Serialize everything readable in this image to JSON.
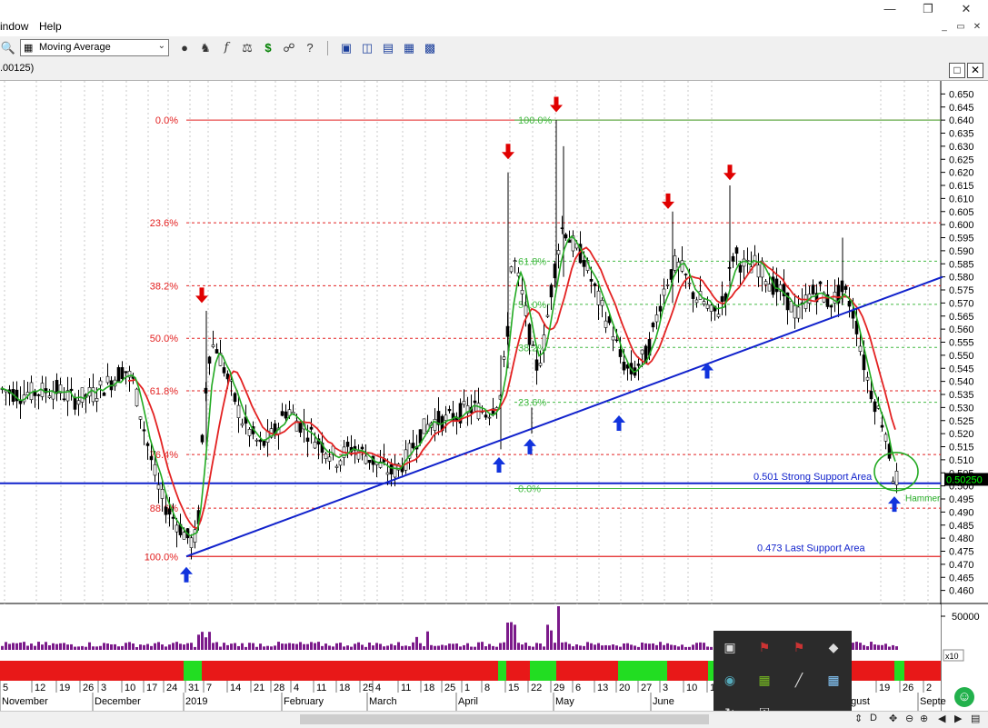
{
  "menu": {
    "window_label": "indow",
    "help_label": "Help"
  },
  "toolbar": {
    "indicator_select": "Moving Average"
  },
  "chart_window": {
    "title_fragment": ".00125)"
  },
  "chart_data": {
    "type": "candlestick",
    "title": "",
    "ylim": [
      0.455,
      0.655
    ],
    "y_ticks": [
      0.65,
      0.645,
      0.64,
      0.635,
      0.63,
      0.625,
      0.62,
      0.615,
      0.61,
      0.605,
      0.6,
      0.595,
      0.59,
      0.585,
      0.58,
      0.575,
      0.57,
      0.565,
      0.56,
      0.555,
      0.55,
      0.545,
      0.54,
      0.535,
      0.53,
      0.525,
      0.52,
      0.515,
      0.51,
      0.505,
      0.5,
      0.495,
      0.49,
      0.485,
      0.48,
      0.475,
      0.47,
      0.465,
      0.46
    ],
    "y_tick_labels": [
      "0.650",
      "0.645",
      "0.640",
      "0.635",
      "0.630",
      "0.625",
      "0.620",
      "0.615",
      "0.610",
      "0.605",
      "0.600",
      "0.595",
      "0.590",
      "0.585",
      "0.580",
      "0.575",
      "0.570",
      "0.565",
      "0.560",
      "0.555",
      "0.550",
      "0.545",
      "0.540",
      "0.535",
      "0.530",
      "0.525",
      "0.520",
      "0.515",
      "0.510",
      "0.505",
      "0.500",
      "0.495",
      "0.490",
      "0.485",
      "0.480",
      "0.475",
      "0.470",
      "0.465",
      "0.460"
    ],
    "last_price_label": "0.50250",
    "last_price": 0.5025,
    "price_path": [
      [
        0,
        0.537
      ],
      [
        20,
        0.535
      ],
      [
        40,
        0.536
      ],
      [
        60,
        0.537
      ],
      [
        80,
        0.533
      ],
      [
        100,
        0.535
      ],
      [
        120,
        0.54
      ],
      [
        135,
        0.545
      ],
      [
        145,
        0.54
      ],
      [
        155,
        0.525
      ],
      [
        165,
        0.51
      ],
      [
        175,
        0.496
      ],
      [
        185,
        0.49
      ],
      [
        195,
        0.485
      ],
      [
        205,
        0.48
      ],
      [
        212,
        0.478
      ],
      [
        218,
        0.49
      ],
      [
        222,
        0.525
      ],
      [
        228,
        0.55
      ],
      [
        235,
        0.555
      ],
      [
        245,
        0.545
      ],
      [
        255,
        0.535
      ],
      [
        265,
        0.525
      ],
      [
        275,
        0.52
      ],
      [
        285,
        0.515
      ],
      [
        300,
        0.52
      ],
      [
        315,
        0.53
      ],
      [
        325,
        0.525
      ],
      [
        340,
        0.52
      ],
      [
        355,
        0.515
      ],
      [
        370,
        0.51
      ],
      [
        385,
        0.515
      ],
      [
        400,
        0.512
      ],
      [
        415,
        0.508
      ],
      [
        430,
        0.505
      ],
      [
        445,
        0.51
      ],
      [
        460,
        0.52
      ],
      [
        475,
        0.525
      ],
      [
        490,
        0.525
      ],
      [
        505,
        0.528
      ],
      [
        520,
        0.53
      ],
      [
        535,
        0.528
      ],
      [
        550,
        0.535
      ],
      [
        557,
        0.56
      ],
      [
        562,
        0.59
      ],
      [
        568,
        0.58
      ],
      [
        575,
        0.57
      ],
      [
        580,
        0.56
      ],
      [
        585,
        0.55
      ],
      [
        590,
        0.545
      ],
      [
        597,
        0.555
      ],
      [
        605,
        0.575
      ],
      [
        612,
        0.59
      ],
      [
        618,
        0.6
      ],
      [
        625,
        0.595
      ],
      [
        632,
        0.59
      ],
      [
        640,
        0.588
      ],
      [
        648,
        0.58
      ],
      [
        656,
        0.572
      ],
      [
        664,
        0.565
      ],
      [
        672,
        0.56
      ],
      [
        680,
        0.55
      ],
      [
        688,
        0.545
      ],
      [
        695,
        0.543
      ],
      [
        703,
        0.548
      ],
      [
        710,
        0.55
      ],
      [
        718,
        0.56
      ],
      [
        726,
        0.572
      ],
      [
        734,
        0.58
      ],
      [
        742,
        0.585
      ],
      [
        750,
        0.582
      ],
      [
        758,
        0.575
      ],
      [
        766,
        0.572
      ],
      [
        774,
        0.57
      ],
      [
        782,
        0.565
      ],
      [
        790,
        0.568
      ],
      [
        798,
        0.575
      ],
      [
        806,
        0.59
      ],
      [
        814,
        0.585
      ],
      [
        822,
        0.583
      ],
      [
        830,
        0.585
      ],
      [
        838,
        0.582
      ],
      [
        846,
        0.578
      ],
      [
        854,
        0.575
      ],
      [
        862,
        0.573
      ],
      [
        870,
        0.568
      ],
      [
        878,
        0.565
      ],
      [
        886,
        0.572
      ],
      [
        894,
        0.574
      ],
      [
        902,
        0.575
      ],
      [
        910,
        0.57
      ],
      [
        918,
        0.572
      ],
      [
        926,
        0.575
      ],
      [
        934,
        0.57
      ],
      [
        942,
        0.56
      ],
      [
        950,
        0.545
      ],
      [
        958,
        0.535
      ],
      [
        966,
        0.528
      ],
      [
        974,
        0.52
      ],
      [
        980,
        0.5045
      ],
      [
        986,
        0.5025
      ]
    ],
    "fibonacci_left": {
      "levels": [
        {
          "label": "0.0%",
          "value": 0.64
        },
        {
          "label": "23.6%",
          "value": 0.6007
        },
        {
          "label": "38.2%",
          "value": 0.5766
        },
        {
          "label": "50.0%",
          "value": 0.5565
        },
        {
          "label": "61.8%",
          "value": 0.5364
        },
        {
          "label": "76.4%",
          "value": 0.512
        },
        {
          "label": "88.6%",
          "value": 0.4915
        },
        {
          "label": "100.0%",
          "value": 0.473
        }
      ]
    },
    "fibonacci_right": {
      "levels": [
        {
          "label": "100.0%",
          "value": 0.64
        },
        {
          "label": "61.8%",
          "value": 0.586
        },
        {
          "label": "50.0%",
          "value": 0.5695
        },
        {
          "label": "38.2%",
          "value": 0.553
        },
        {
          "label": "23.6%",
          "value": 0.532
        },
        {
          "label": "0.0%",
          "value": 0.499
        }
      ]
    },
    "horizontal_lines": [
      {
        "label": "0.501 Strong Support Area",
        "value": 0.501
      },
      {
        "label": "0.473 Last Support Area",
        "value": 0.473
      }
    ],
    "trendline": {
      "from": [
        205,
        0.473
      ],
      "to": [
        1037,
        0.58
      ]
    },
    "down_arrows": [
      [
        222,
        0.57
      ],
      [
        559,
        0.625
      ],
      [
        612,
        0.643
      ],
      [
        735,
        0.606
      ],
      [
        803,
        0.617
      ]
    ],
    "up_arrows": [
      [
        205,
        0.469
      ],
      [
        549,
        0.511
      ],
      [
        583,
        0.518
      ],
      [
        681,
        0.527
      ],
      [
        778,
        0.547
      ],
      [
        984,
        0.496
      ]
    ],
    "annotation": {
      "label": "Hammer",
      "x": 996,
      "value": 0.4955
    },
    "volume_axis_label": "50000",
    "volume_multiplier_label": "x10",
    "month_labels": [
      "November",
      "December",
      "2019",
      "February",
      "March",
      "April",
      "May",
      "June",
      "ugust",
      "Septe"
    ],
    "day_labels": [
      "5",
      "12",
      "19",
      "26",
      "3",
      "10",
      "17",
      "24",
      "31",
      "7",
      "14",
      "21",
      "28",
      "4",
      "11",
      "18",
      "25",
      "4",
      "11",
      "18",
      "25",
      "1",
      "8",
      "15",
      "22",
      "29",
      "6",
      "13",
      "20",
      "27",
      "3",
      "10",
      "17",
      "19",
      "26",
      "2"
    ]
  }
}
